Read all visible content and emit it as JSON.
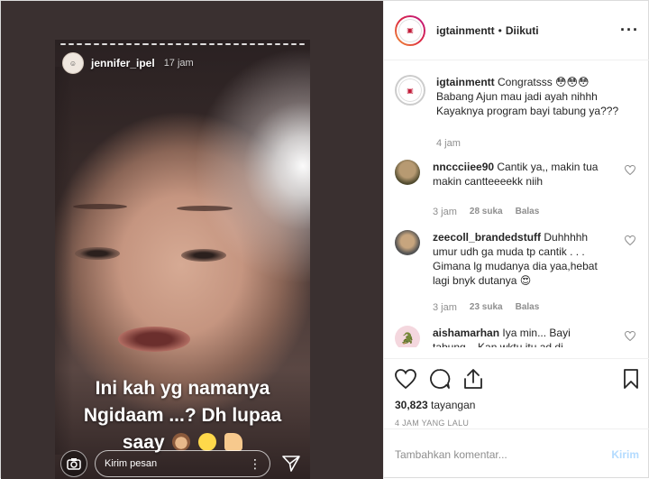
{
  "story": {
    "username": "jennifer_ipel",
    "time": "17 jam",
    "caption_lines": [
      "Ini kah yg namanya",
      "Ngidaam ...? Dh lupaa",
      "saay"
    ],
    "reply_placeholder": "Kirim pesan"
  },
  "header": {
    "username": "igtainmentt",
    "separator": "•",
    "follow_status": "Diikuti"
  },
  "comments": [
    {
      "username": "igtainmentt",
      "lines": [
        "Congratsss 😳😳😳",
        "Babang Ajun mau jadi ayah nihhh",
        "Kayaknya program bayi tabung ya???"
      ],
      "time": "4 jam"
    },
    {
      "username": "nnccciiee90",
      "lines": [
        "Cantik ya,, makin tua",
        "makin cantteeeekk niih"
      ],
      "time": "3 jam",
      "likes": "28 suka",
      "reply": "Balas"
    },
    {
      "username": "zeecoll_brandedstuff",
      "lines": [
        "Duhhhhh",
        "umur udh ga muda tp cantik . . .",
        "Gimana lg mudanya dia yaa,hebat",
        "lagi bnyk dutanya 😍"
      ],
      "time": "3 jam",
      "likes": "23 suka",
      "reply": "Balas"
    },
    {
      "username": "aishamarhan",
      "lines": [
        "Iya min... Bayi",
        "tabung... Kan wktu itu ad di"
      ]
    }
  ],
  "views": {
    "count": "30,823",
    "label": "tayangan"
  },
  "date": "4 JAM YANG LALU",
  "comment_box": {
    "placeholder": "Tambahkan komentar...",
    "post_label": "Kirim"
  },
  "colors": {
    "post_disabled": "#b3dbff",
    "muted": "#8e8e8e"
  }
}
